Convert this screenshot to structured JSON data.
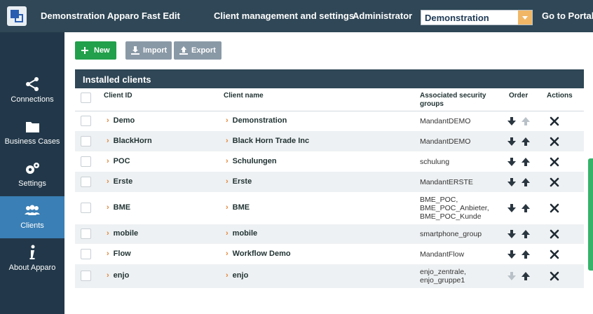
{
  "header": {
    "app_title": "Demonstration Apparo Fast Edit",
    "nav_clients": "Client management and settings",
    "nav_admin": "Administrator",
    "select_value": "Demonstration",
    "portal_link": "Go to Portal"
  },
  "sidebar": {
    "items": [
      {
        "label": "Connections",
        "icon": "share-icon"
      },
      {
        "label": "Business Cases",
        "icon": "folder-icon"
      },
      {
        "label": "Settings",
        "icon": "gears-icon"
      },
      {
        "label": "Clients",
        "icon": "users-icon"
      },
      {
        "label": "About Apparo",
        "icon": "info-icon"
      }
    ]
  },
  "toolbar": {
    "new_label": "New",
    "import_label": "Import",
    "export_label": "Export"
  },
  "panel": {
    "title": "Installed clients",
    "columns": {
      "client_id": "Client ID",
      "client_name": "Client name",
      "groups_line1": "Associated security",
      "groups_line2": "groups",
      "order": "Order",
      "actions": "Actions"
    }
  },
  "clients": [
    {
      "id": "Demo",
      "name": "Demonstration",
      "groups": [
        "MandantDEMO"
      ]
    },
    {
      "id": "BlackHorn",
      "name": "Black Horn Trade Inc",
      "groups": [
        "MandantDEMO"
      ]
    },
    {
      "id": "POC",
      "name": "Schulungen",
      "groups": [
        "schulung"
      ]
    },
    {
      "id": "Erste",
      "name": "Erste",
      "groups": [
        "MandantERSTE"
      ]
    },
    {
      "id": "BME",
      "name": "BME",
      "groups": [
        "BME_POC,",
        "BME_POC_Anbieter,",
        "BME_POC_Kunde"
      ]
    },
    {
      "id": "mobile",
      "name": "mobile",
      "groups": [
        "smartphone_group"
      ]
    },
    {
      "id": "Flow",
      "name": "Workflow Demo",
      "groups": [
        "MandantFlow"
      ]
    },
    {
      "id": "enjo",
      "name": "enjo",
      "groups": [
        "enjo_zentrale,",
        "enjo_gruppe1"
      ]
    }
  ],
  "colors": {
    "topbar": "#2f4756",
    "sidebar": "#22384a",
    "active": "#3a7fb5",
    "new_button": "#22a04b",
    "chevron": "#e0873a"
  }
}
